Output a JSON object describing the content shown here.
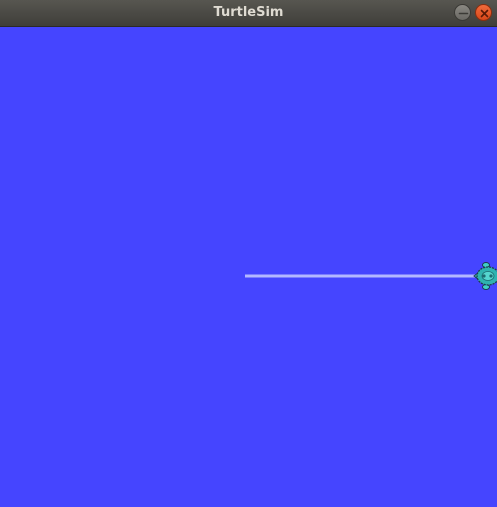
{
  "window": {
    "title": "TurtleSim"
  },
  "titlebar": {
    "buttons": [
      {
        "name": "minimize",
        "icon": "minimize-icon"
      },
      {
        "name": "close",
        "icon": "close-icon"
      }
    ]
  },
  "canvas": {
    "background_color": "#4545ff",
    "pen_color": "#b3b8ff",
    "turtle": {
      "icon": "turtle-icon",
      "shell_color": "#2fb3b0",
      "outline_color": "#1d3b4a"
    }
  },
  "colors": {
    "titlebar": "#4a4944",
    "title_text": "#dfdbd2",
    "close_button": "#e55b2a",
    "minimize_button": "#7d7c77"
  }
}
